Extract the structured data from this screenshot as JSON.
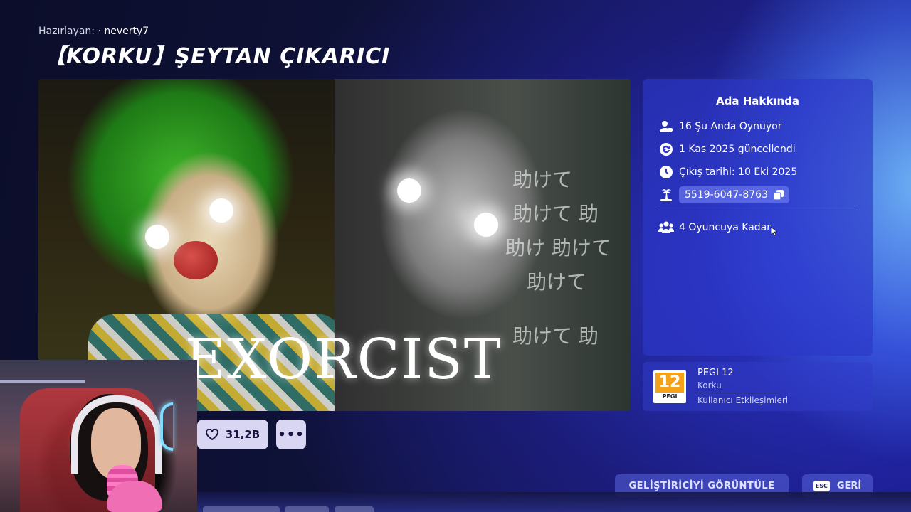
{
  "header": {
    "creator_label": "Hazırlayan: ·",
    "creator_name": "neverty7",
    "title": "【KORKU】ŞEYTAN ÇIKARICI"
  },
  "hero": {
    "overlay_text": "EXORCIST",
    "kanji": [
      "助けて",
      "助けて 助",
      "助け 助けて",
      "助けて",
      "助けて 助"
    ]
  },
  "about": {
    "title": "Ada Hakkında",
    "playing_now": "16 Şu Anda Oynuyor",
    "updated": "1 Kas 2025 güncellendi",
    "release": "Çıkış tarihi: 10 Eki 2025",
    "island_code": "5519-6047-8763",
    "max_players": "4 Oyuncuya Kadar"
  },
  "rating": {
    "badge_number": "12",
    "badge_label": "PEGI",
    "name": "PEGI 12",
    "genre": "Korku",
    "note": "Kullanıcı Etkileşimleri"
  },
  "actions": {
    "likes": "31,2B",
    "more": "•••",
    "view_developer": "GELİŞTİRİCİYİ GÖRÜNTÜLE",
    "esc_key": "ESC",
    "back": "GERİ"
  },
  "icons": [
    "players-icon",
    "refresh-icon",
    "clock-icon",
    "island-icon",
    "copy-icon",
    "group-icon",
    "heart-icon",
    "cursor-icon"
  ],
  "colors": {
    "panel": "#2d37c8",
    "button_light": "#d9d6f4",
    "pegi_orange": "#f4a21a"
  }
}
